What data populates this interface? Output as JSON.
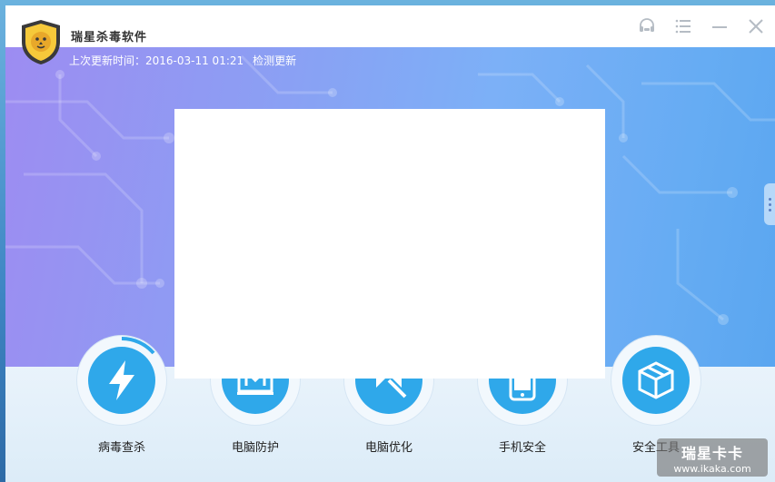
{
  "app": {
    "title": "瑞星杀毒软件"
  },
  "update": {
    "last_update_label": "上次更新时间：2016-03-11 01:21",
    "check_label": "检测更新"
  },
  "tools": [
    {
      "label": "病毒查杀",
      "icon": "lightning-icon"
    },
    {
      "label": "电脑防护",
      "icon": "shield-m-icon"
    },
    {
      "label": "电脑优化",
      "icon": "rocket-icon"
    },
    {
      "label": "手机安全",
      "icon": "phone-icon"
    },
    {
      "label": "安全工具",
      "icon": "box-icon"
    }
  ],
  "watermark": {
    "brand": "瑞星卡卡",
    "url": "www.ikaka.com"
  },
  "colors": {
    "accent": "#2fa8ea",
    "hero_start": "#9d8cf2",
    "hero_end": "#5aa6f0"
  }
}
